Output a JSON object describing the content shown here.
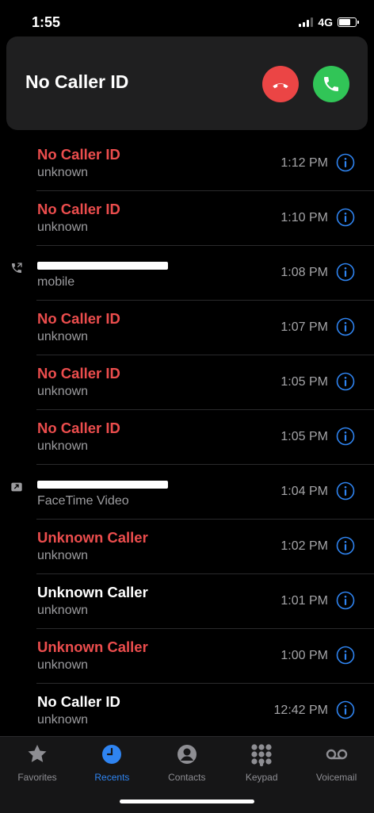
{
  "status_bar": {
    "time": "1:55",
    "network": "4G",
    "battery_level": 0.75
  },
  "incoming_call": {
    "caller": "No Caller ID"
  },
  "calls": [
    {
      "name": "No Caller ID",
      "type": "unknown",
      "time": "1:12 PM",
      "missed": true,
      "side_icon": "none"
    },
    {
      "name": "No Caller ID",
      "type": "unknown",
      "time": "1:10 PM",
      "missed": true,
      "side_icon": "none"
    },
    {
      "name": "",
      "type": "mobile",
      "time": "1:08 PM",
      "missed": false,
      "side_icon": "outgoing-call-icon"
    },
    {
      "name": "No Caller ID",
      "type": "unknown",
      "time": "1:07 PM",
      "missed": true,
      "side_icon": "none"
    },
    {
      "name": "No Caller ID",
      "type": "unknown",
      "time": "1:05 PM",
      "missed": true,
      "side_icon": "none"
    },
    {
      "name": "No Caller ID",
      "type": "unknown",
      "time": "1:05 PM",
      "missed": true,
      "side_icon": "none"
    },
    {
      "name": "",
      "type": "FaceTime Video",
      "time": "1:04 PM",
      "missed": false,
      "side_icon": "outgoing-facetime-icon"
    },
    {
      "name": "Unknown Caller",
      "type": "unknown",
      "time": "1:02 PM",
      "missed": true,
      "side_icon": "none"
    },
    {
      "name": "Unknown Caller",
      "type": "unknown",
      "time": "1:01 PM",
      "missed": false,
      "side_icon": "none"
    },
    {
      "name": "Unknown Caller",
      "type": "unknown",
      "time": "1:00 PM",
      "missed": true,
      "side_icon": "none"
    },
    {
      "name": "No Caller ID",
      "type": "unknown",
      "time": "12:42 PM",
      "missed": false,
      "side_icon": "none"
    }
  ],
  "tabs": [
    {
      "label": "Favorites",
      "icon": "star-icon",
      "active": false
    },
    {
      "label": "Recents",
      "icon": "clock-icon",
      "active": true
    },
    {
      "label": "Contacts",
      "icon": "person-icon",
      "active": false
    },
    {
      "label": "Keypad",
      "icon": "keypad-icon",
      "active": false
    },
    {
      "label": "Voicemail",
      "icon": "voicemail-icon",
      "active": false
    }
  ],
  "colors": {
    "missed": "#eb4d4d",
    "accent": "#2f84f1",
    "decline": "#eb4545",
    "accept": "#31c557"
  }
}
